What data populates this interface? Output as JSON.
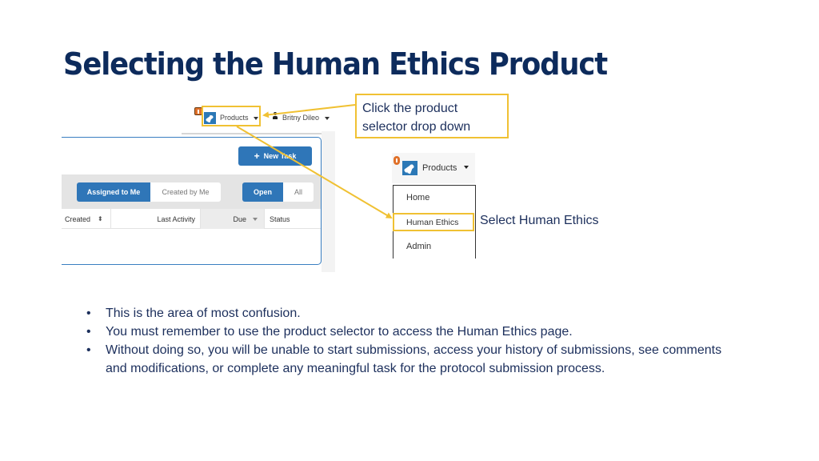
{
  "slide": {
    "title": "Selecting the Human Ethics Product"
  },
  "app_screenshot": {
    "nav": {
      "products_label": "Products",
      "user_name": "Britny Dileo"
    },
    "new_task_button": "New Task",
    "filters": {
      "assignment": [
        {
          "label": "Assigned to Me",
          "active": true
        },
        {
          "label": "Created by Me",
          "active": false
        }
      ],
      "state": [
        {
          "label": "Open",
          "active": true
        },
        {
          "label": "All",
          "active": false
        }
      ]
    },
    "columns": [
      "Created",
      "Last Activity",
      "Due",
      "Status"
    ]
  },
  "dropdown_screenshot": {
    "products_label": "Products",
    "menu_items": [
      "Home",
      "Human Ethics",
      "Admin"
    ],
    "highlighted_item": "Human Ethics"
  },
  "callouts": {
    "products_selector": "Click the product selector drop down",
    "products_selector_lines": [
      "Click the product",
      "selector drop down"
    ],
    "human_ethics": "Select Human Ethics"
  },
  "bullets": [
    "This is the area of most confusion.",
    "You must remember to use the product selector to access the Human Ethics page.",
    "Without doing so, you will be unable to start submissions, access your history of submissions, see comments and modifications, or complete any meaningful task for the protocol submission process."
  ],
  "colors": {
    "title": "#0d2b5c",
    "accent_highlight": "#f0c133",
    "app_primary": "#2f76b8",
    "body_text": "#1c2f5c"
  }
}
